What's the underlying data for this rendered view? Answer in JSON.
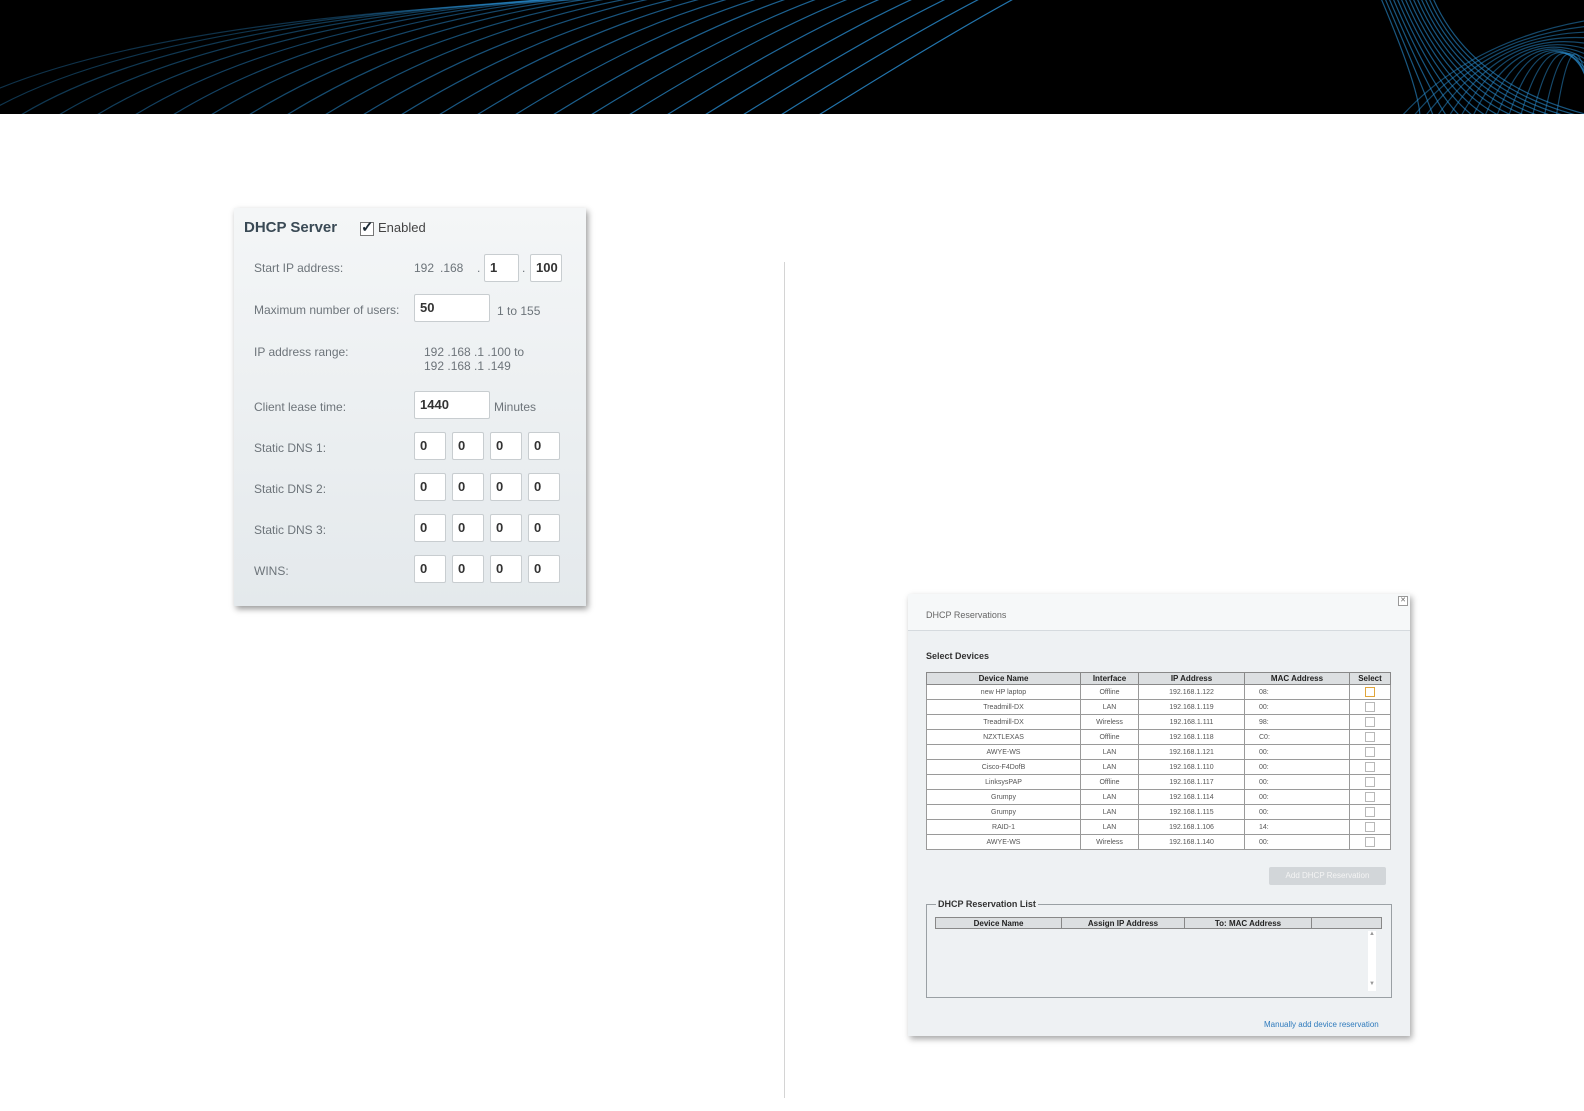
{
  "dhcp_server": {
    "title": "DHCP Server",
    "enabled_label": "Enabled",
    "enabled_checked": true,
    "start_ip": {
      "label": "Start IP address:",
      "fixed_prefix_1": "192",
      "fixed_prefix_2": ".168",
      "sep1": ".",
      "octet3": "1",
      "sep2": ".",
      "octet4": "100"
    },
    "max_users": {
      "label": "Maximum number of users:",
      "value": "50",
      "hint": "1 to 155"
    },
    "ip_range": {
      "label": "IP address range:",
      "line1": "192 .168 .1 .100  to",
      "line2": "192 .168 .1 .149"
    },
    "lease_time": {
      "label": "Client lease time:",
      "value": "1440",
      "unit": "Minutes"
    },
    "dns1": {
      "label": "Static DNS 1:",
      "octets": [
        "0",
        "0",
        "0",
        "0"
      ]
    },
    "dns2": {
      "label": "Static DNS 2:",
      "octets": [
        "0",
        "0",
        "0",
        "0"
      ]
    },
    "dns3": {
      "label": "Static DNS 3:",
      "octets": [
        "0",
        "0",
        "0",
        "0"
      ]
    },
    "wins": {
      "label": "WINS:",
      "octets": [
        "0",
        "0",
        "0",
        "0"
      ]
    }
  },
  "reservations": {
    "title": "DHCP Reservations",
    "select_devices_label": "Select Devices",
    "columns": [
      "Device Name",
      "Interface",
      "IP Address",
      "MAC Address",
      "Select"
    ],
    "rows": [
      {
        "name": "new HP laptop",
        "interface": "Offline",
        "ip": "192.168.1.122",
        "mac": "08:",
        "selected": true
      },
      {
        "name": "Treadmill-DX",
        "interface": "LAN",
        "ip": "192.168.1.119",
        "mac": "00:",
        "selected": false
      },
      {
        "name": "Treadmill-DX",
        "interface": "Wireless",
        "ip": "192.168.1.111",
        "mac": "98:",
        "selected": false
      },
      {
        "name": "NZXTLEXAS",
        "interface": "Offline",
        "ip": "192.168.1.118",
        "mac": "C0:",
        "selected": false
      },
      {
        "name": "AWYE-WS",
        "interface": "LAN",
        "ip": "192.168.1.121",
        "mac": "00:",
        "selected": false
      },
      {
        "name": "Cisco-F4DofB",
        "interface": "LAN",
        "ip": "192.168.1.110",
        "mac": "00:",
        "selected": false
      },
      {
        "name": "LinksysPAP",
        "interface": "Offline",
        "ip": "192.168.1.117",
        "mac": "00:",
        "selected": false
      },
      {
        "name": "Grumpy",
        "interface": "LAN",
        "ip": "192.168.1.114",
        "mac": "00:",
        "selected": false
      },
      {
        "name": "Grumpy",
        "interface": "LAN",
        "ip": "192.168.1.115",
        "mac": "00:",
        "selected": false
      },
      {
        "name": "RAID-1",
        "interface": "LAN",
        "ip": "192.168.1.106",
        "mac": "14:",
        "selected": false
      },
      {
        "name": "AWYE-WS",
        "interface": "Wireless",
        "ip": "192.168.1.140",
        "mac": "00:",
        "selected": false
      }
    ],
    "add_button": "Add DHCP Reservation",
    "list_title": "DHCP Reservation List",
    "list_columns": [
      "Device Name",
      "Assign IP Address",
      "To: MAC Address",
      ""
    ],
    "manual_link": "Manually add device reservation"
  },
  "colors": {
    "header_band": "#000000",
    "header_lines": "#2a8fd4",
    "panel_title": "#3a4a55",
    "link": "#2f7bbd",
    "selected_checkbox": "#e0a53a"
  }
}
